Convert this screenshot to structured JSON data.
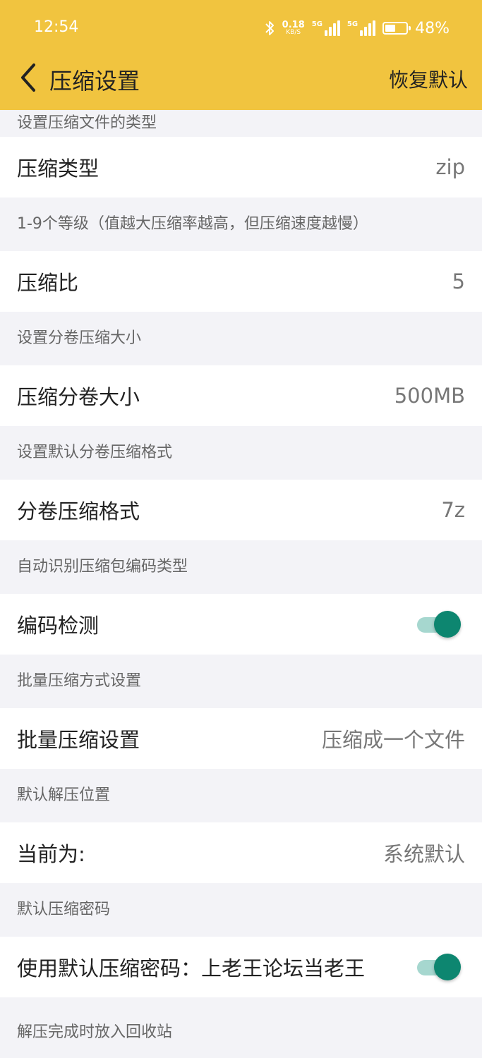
{
  "status_bar": {
    "time": "12:54",
    "net_speed_value": "0.18",
    "net_speed_unit": "KB/S",
    "signal1_label": "5G",
    "signal2_label": "5G",
    "battery": "48%"
  },
  "header": {
    "title": "压缩设置",
    "reset_label": "恢复默认"
  },
  "sections": [
    {
      "label": "设置压缩文件的类型",
      "row_label": "压缩类型",
      "row_value": "zip"
    },
    {
      "label": "1-9个等级（值越大压缩率越高，但压缩速度越慢）",
      "row_label": "压缩比",
      "row_value": "5"
    },
    {
      "label": "设置分卷压缩大小",
      "row_label": "压缩分卷大小",
      "row_value": "500MB"
    },
    {
      "label": "设置默认分卷压缩格式",
      "row_label": "分卷压缩格式",
      "row_value": "7z"
    },
    {
      "label": "自动识别压缩包编码类型",
      "row_label": "编码检测",
      "toggle_on": true
    },
    {
      "label": "批量压缩方式设置",
      "row_label": "批量压缩设置",
      "row_value": "压缩成一个文件"
    },
    {
      "label": "默认解压位置",
      "row_label": "当前为:",
      "row_value": "系统默认"
    },
    {
      "label": "默认压缩密码",
      "row_label": "使用默认压缩密码：上老王论坛当老王",
      "toggle_on": true
    },
    {
      "label": "解压完成时放入回收站"
    }
  ],
  "colors": {
    "header_bg": "#f1c43f",
    "toggle_knob": "#0d8670",
    "toggle_track": "#a6d7cf",
    "page_bg": "#f3f3f7"
  }
}
